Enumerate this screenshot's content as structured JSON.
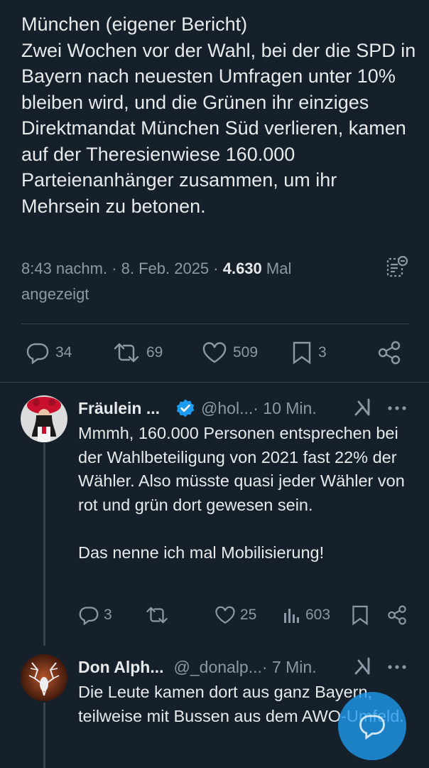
{
  "main_tweet": {
    "text": "München (eigener Bericht)\nZwei Wochen vor der Wahl, bei der die SPD in Bayern nach neuesten Umfragen unter 10% bleiben wird, und die Grünen ihr einziges Direktmandat München Süd verlieren, kamen auf der Theresienwiese 160.000 Parteienanhänger zusammen, um ihr Mehrsein zu betonen.",
    "time": "8:43 nachm. · 8. Feb. 2025 · ",
    "views": "4.630",
    "views_suffix": " Mal angezeigt",
    "stats": {
      "replies": "34",
      "retweets": "69",
      "likes": "509",
      "bookmarks": "3"
    }
  },
  "replies": [
    {
      "name": "Fräulein ...",
      "handle": "@hol...",
      "time": " · 10 Min.",
      "verified": true,
      "text": "Mmmh, 160.000 Personen entsprechen bei der Wahlbeteiligung von 2021 fast 22% der Wähler. Also müsste quasi jeder Wähler von rot und grün dort gewesen sein.\n\nDas nenne ich mal Mobilisierung!",
      "replies": "3",
      "retweets": "",
      "likes": "25",
      "views": "603"
    },
    {
      "name": "Don Alph...",
      "handle": "@_donalp...",
      "time": " · 7 Min.",
      "verified": false,
      "text": "Die Leute kamen dort aus ganz Bayern, teilweise mit Bussen aus dem AWO-Umfeld."
    }
  ],
  "icons": {
    "reply": "reply-icon",
    "retweet": "retweet-icon",
    "like": "heart-icon",
    "bookmark": "bookmark-icon",
    "share": "share-icon",
    "grok": "grok-icon",
    "more": "more-icon",
    "views": "views-icon",
    "verified": "verified-badge-icon",
    "compose": "reply-compose-icon"
  },
  "colors": {
    "background": "#15202b",
    "text": "#e7e9ea",
    "muted": "#8b98a5",
    "accent": "#1d9bf0"
  }
}
